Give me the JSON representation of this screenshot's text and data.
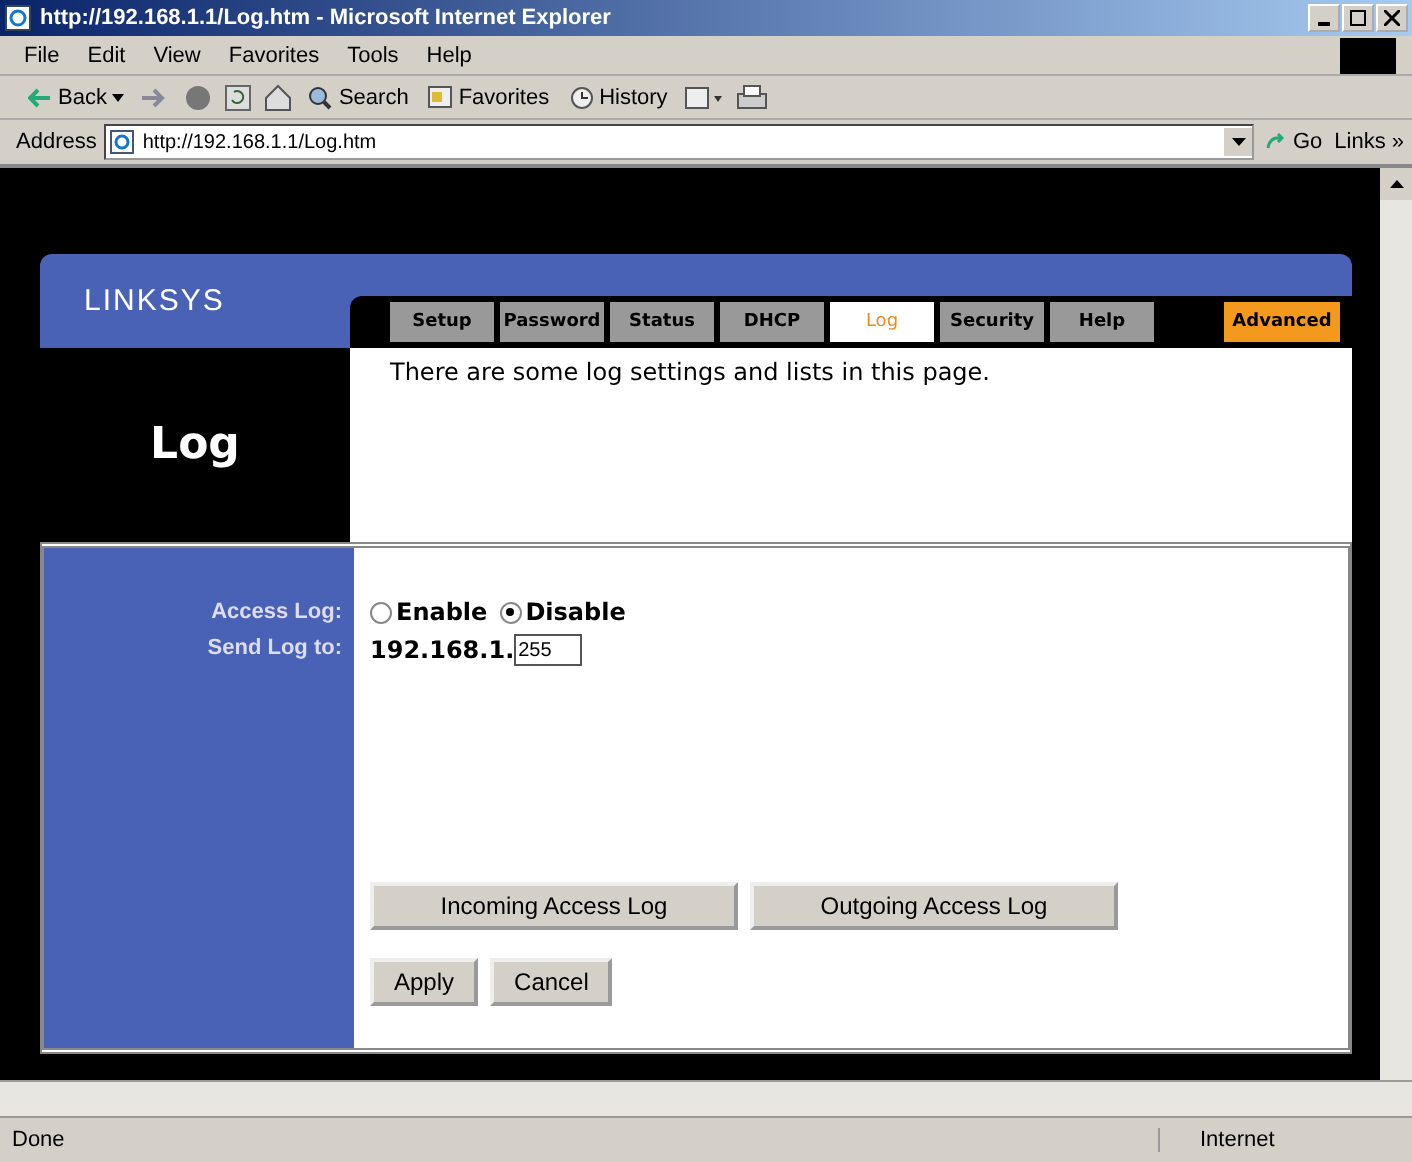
{
  "window": {
    "title": "http://192.168.1.1/Log.htm - Microsoft Internet Explorer"
  },
  "menu": [
    "File",
    "Edit",
    "View",
    "Favorites",
    "Tools",
    "Help"
  ],
  "toolbar": {
    "back": "Back",
    "search": "Search",
    "favorites": "Favorites",
    "history": "History"
  },
  "address": {
    "label": "Address",
    "value": "http://192.168.1.1/Log.htm",
    "go": "Go",
    "links": "Links »"
  },
  "page": {
    "logo": "LINKSYS",
    "title": "Log",
    "description": "There are some log settings and lists in this page.",
    "tabs": [
      {
        "label": "Setup",
        "selected": false,
        "kind": "normal"
      },
      {
        "label": "Password",
        "selected": false,
        "kind": "normal"
      },
      {
        "label": "Status",
        "selected": false,
        "kind": "normal"
      },
      {
        "label": "DHCP",
        "selected": false,
        "kind": "normal"
      },
      {
        "label": "Log",
        "selected": true,
        "kind": "normal"
      },
      {
        "label": "Security",
        "selected": false,
        "kind": "normal"
      },
      {
        "label": "Help",
        "selected": false,
        "kind": "normal"
      },
      {
        "label": "Advanced",
        "selected": false,
        "kind": "advanced"
      }
    ],
    "access_log": {
      "label": "Access Log:",
      "options": [
        {
          "label": "Enable",
          "selected": false
        },
        {
          "label": "Disable",
          "selected": true
        }
      ]
    },
    "send_log": {
      "label": "Send Log to:",
      "prefix": "192.168.1.",
      "value": "255"
    },
    "log_buttons": [
      "Incoming Access Log",
      "Outgoing Access Log"
    ],
    "buttons": [
      "Apply",
      "Cancel"
    ]
  },
  "status_bar": {
    "text": "Done",
    "zone": "Internet"
  }
}
